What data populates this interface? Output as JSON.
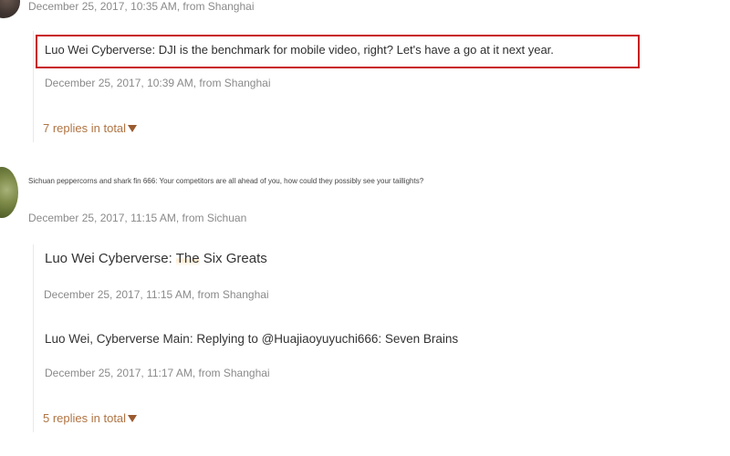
{
  "comment1": {
    "timestamp": "December 25, 2017, 10:35 AM, from Shanghai",
    "reply": {
      "text": "Luo Wei Cyberverse: DJI is the benchmark for mobile video, right? Let's have a go at it next year.",
      "timestamp": "December 25, 2017, 10:39 AM, from Shanghai"
    },
    "replies_link": "7 replies in total"
  },
  "comment2": {
    "text": "Sichuan peppercorns and shark fin 666: Your competitors are all ahead of you, how could they possibly see your taillights?",
    "timestamp": "December 25, 2017, 11:15 AM, from Sichuan",
    "replies": [
      {
        "text_prefix": "Luo Wei Cyberverse: ",
        "text_highlight": "The",
        "text_suffix": " Six Greats",
        "timestamp": "December 25, 2017, 11:15 AM, from Shanghai"
      },
      {
        "text": "Luo Wei, Cyberverse Main: Replying to @Huajiaoyuyuchi666: Seven Brains",
        "timestamp": "December 25, 2017, 11:17 AM, from Shanghai"
      }
    ],
    "replies_link": "5 replies in total"
  },
  "colors": {
    "highlight_border": "#c8171e",
    "replies_link": "#b07443",
    "meta_text": "#8a8a8a"
  },
  "icons": {
    "expand": "triangle-down-icon"
  }
}
